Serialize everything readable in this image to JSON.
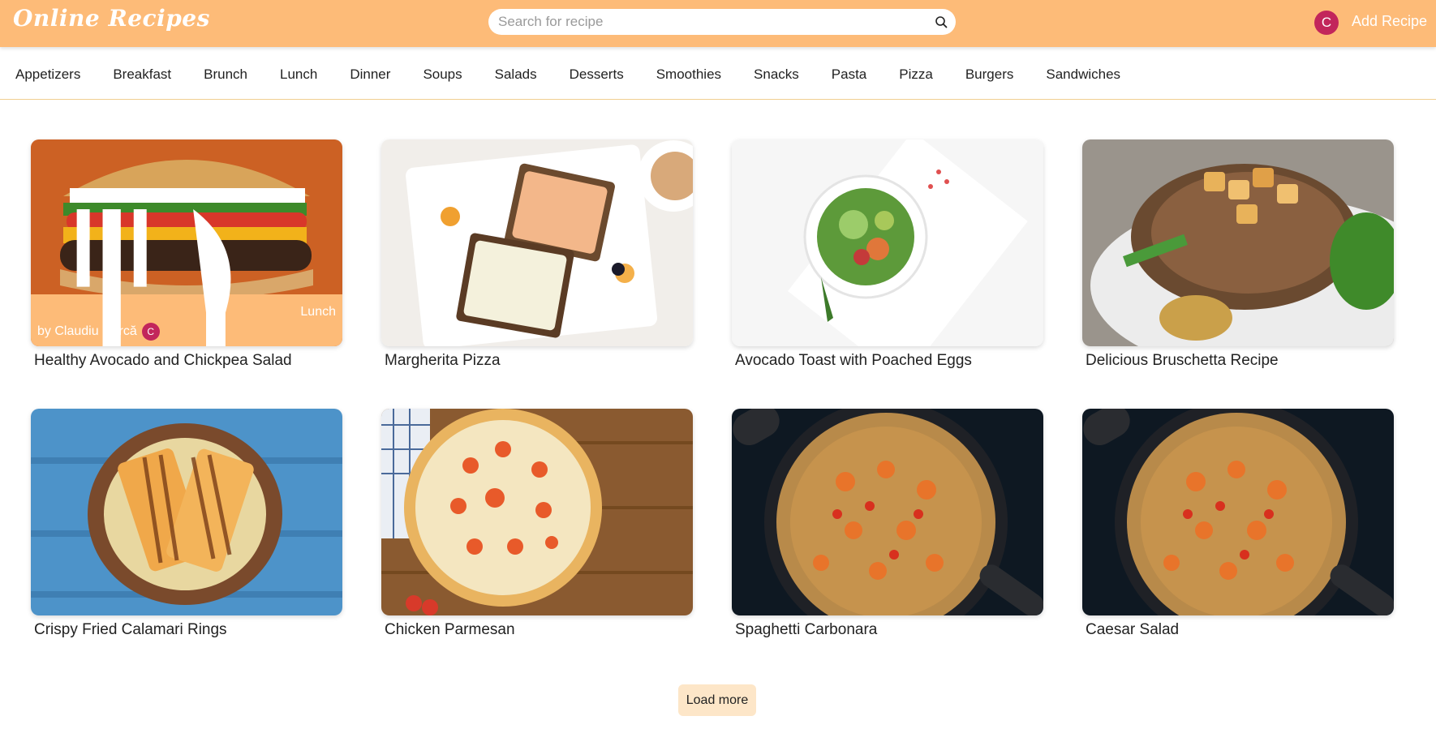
{
  "header": {
    "logo": "Online Recipes",
    "search_placeholder": "Search for recipe",
    "user_initial": "C",
    "add_recipe_label": "Add Recipe"
  },
  "categories": [
    "Appetizers",
    "Breakfast",
    "Brunch",
    "Lunch",
    "Dinner",
    "Soups",
    "Salads",
    "Desserts",
    "Smoothies",
    "Snacks",
    "Pasta",
    "Pizza",
    "Burgers",
    "Sandwiches"
  ],
  "hover_card": {
    "category": "Lunch",
    "author": "by Claudiu Curcă",
    "author_initial": "C"
  },
  "recipes": [
    {
      "title": "Healthy Avocado and Chickpea Salad",
      "image": "burger"
    },
    {
      "title": "Margherita Pizza",
      "image": "toast-platter"
    },
    {
      "title": "Avocado Toast with Poached Eggs",
      "image": "salad-bowl"
    },
    {
      "title": "Delicious Bruschetta Recipe",
      "image": "pork-chop"
    },
    {
      "title": "Crispy Fried Calamari Rings",
      "image": "grilled-sandwich"
    },
    {
      "title": "Chicken Parmesan",
      "image": "pizza"
    },
    {
      "title": "Spaghetti Carbonara",
      "image": "shrimp-pasta-pan"
    },
    {
      "title": "Caesar Salad",
      "image": "shrimp-pasta-pan"
    }
  ],
  "load_more_label": "Load more",
  "colors": {
    "header_bg": "#fdbb78",
    "avatar": "#c2265b",
    "load_more_bg": "#fde6c8"
  }
}
